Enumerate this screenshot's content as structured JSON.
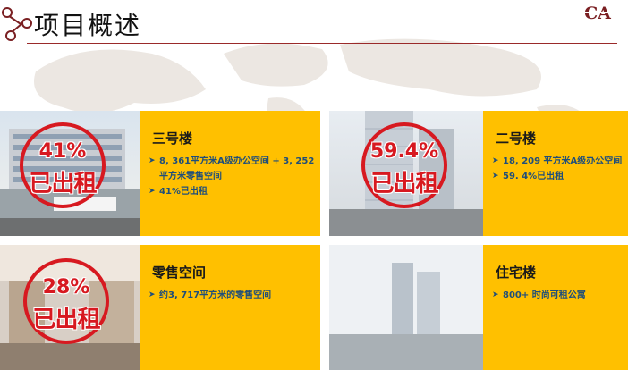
{
  "page": {
    "title": "项目概述",
    "logo_text": "CA"
  },
  "colors": {
    "accent": "#7a1f22",
    "panel": "#ffc000",
    "stamp": "#d71920",
    "bullet_text": "#1f4e7a"
  },
  "cards": [
    {
      "stamp_pct": "41%",
      "stamp_label": "已出租",
      "title": "三号楼",
      "bullets": [
        "8, 361平方米A级办公空间 + 3, 252平方米零售空间",
        "41%已出租"
      ]
    },
    {
      "stamp_pct": "59.4%",
      "stamp_label": "已出租",
      "title": "二号楼",
      "bullets": [
        "18, 209 平方米A级办公空间",
        "59. 4%已出租"
      ]
    },
    {
      "stamp_pct": "28%",
      "stamp_label": "已出租",
      "title": "零售空间",
      "bullets": [
        "约3, 717平方米的零售空间"
      ]
    },
    {
      "title": "住宅楼",
      "bullets": [
        "800+ 时尚可租公寓"
      ]
    }
  ]
}
